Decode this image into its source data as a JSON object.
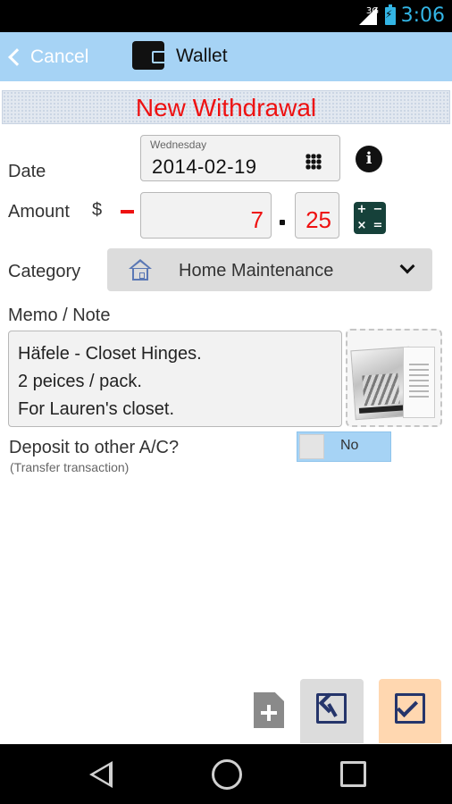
{
  "status_bar": {
    "network": "3G",
    "time": "3:06"
  },
  "action_bar": {
    "cancel_label": "Cancel",
    "title": "Wallet"
  },
  "header": {
    "title": "New Withdrawal"
  },
  "form": {
    "date": {
      "label": "Date",
      "weekday": "Wednesday",
      "value": "2014-02-19"
    },
    "amount": {
      "label": "Amount",
      "currency_symbol": "$",
      "sign": "-",
      "whole": "7",
      "cents": "25"
    },
    "category": {
      "label": "Category",
      "value": "Home Maintenance",
      "icon": "house-icon"
    },
    "memo": {
      "label": "Memo / Note",
      "lines": [
        "Häfele - Closet Hinges.",
        "2 peices / pack.",
        "For Lauren's closet."
      ]
    },
    "deposit": {
      "question": "Deposit to other A/C?",
      "subtitle": "(Transfer transaction)",
      "toggle_label": "No",
      "toggle_on": false
    }
  },
  "colors": {
    "accent": "#a6d3f5",
    "title_red": "#ee1111",
    "confirm_bg": "#ffd7b0",
    "icon_navy": "#25356b"
  }
}
